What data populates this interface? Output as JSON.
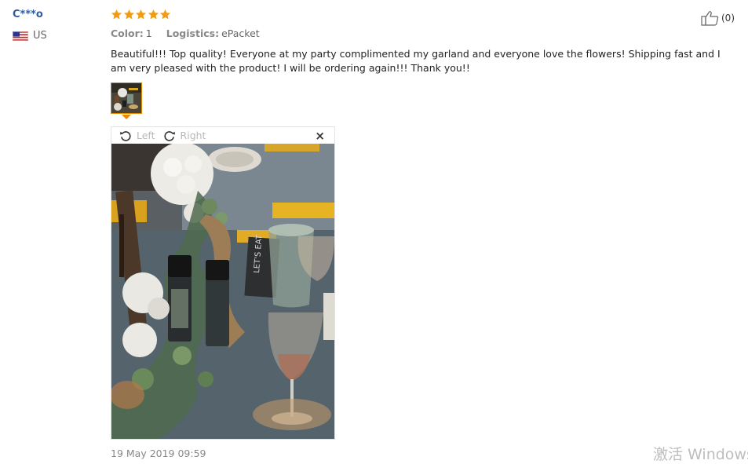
{
  "reviewer": {
    "name": "C***o",
    "country": "US"
  },
  "rating": {
    "stars": 5,
    "max": 5,
    "color": "#f39c12"
  },
  "attributes": [
    {
      "key": "Color:",
      "value": "1"
    },
    {
      "key": "Logistics:",
      "value": "ePacket"
    }
  ],
  "review": {
    "text": "Beautiful!!! Top quality! Everyone at my party complimented my garland and everyone love the flowers! Shipping fast and I am very pleased with the product! I will be ordering again!!! Thank you!!"
  },
  "helpful": {
    "count": "(0)"
  },
  "viewer": {
    "left_label": "Left",
    "right_label": "Right",
    "close_label": "×"
  },
  "date": "19 May 2019 09:59",
  "watermark": "激活 Windows"
}
